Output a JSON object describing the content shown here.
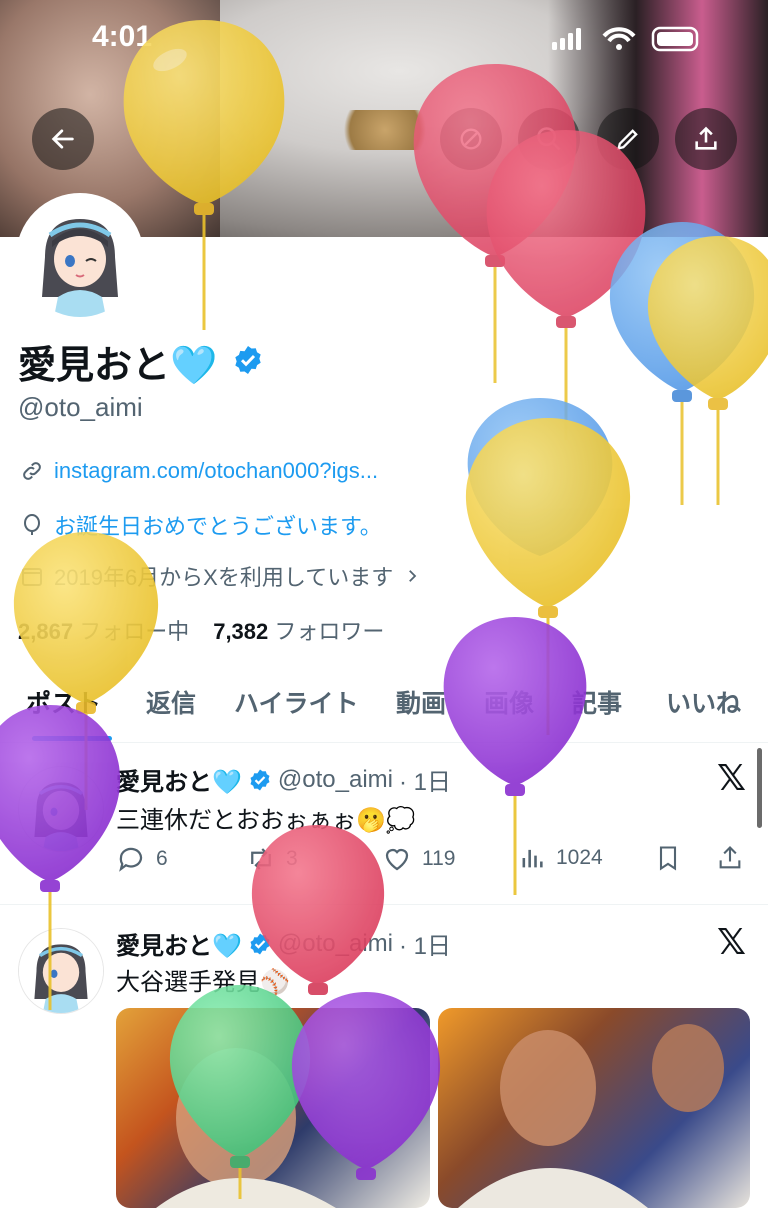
{
  "status_bar": {
    "time": "4:01"
  },
  "profile": {
    "display_name": "愛見おと🩵",
    "handle": "@oto_aimi",
    "link": "instagram.com/otochan000?igs...",
    "birthday": "お誕生日おめでとうございます。",
    "joined": "2019年6月からXを利用しています",
    "following_count": "2,867",
    "following_label": "フォロー中",
    "followers_count": "7,382",
    "followers_label": "フォロワー"
  },
  "tabs": [
    {
      "label": "ポスト"
    },
    {
      "label": "返信"
    },
    {
      "label": "ハイライト"
    },
    {
      "label": "動画"
    },
    {
      "label": "画像"
    },
    {
      "label": "記事"
    },
    {
      "label": "いいね"
    }
  ],
  "tweets": [
    {
      "name": "愛見おと🩵",
      "handle": "@oto_aimi",
      "time": "· 1日",
      "text": "三連休だとおおぉぁぉ🫢💭",
      "replies": "6",
      "retweets": "3",
      "likes": "119",
      "views": "1024"
    },
    {
      "name": "愛見おと🩵",
      "handle": "@oto_aimi",
      "time": "· 1日",
      "text": "大谷選手発見⚾️"
    }
  ],
  "icons": [
    "back-arrow-icon",
    "grok-icon",
    "search-icon",
    "edit-pencil-icon",
    "share-icon",
    "link-icon",
    "balloon-icon",
    "calendar-icon",
    "chevron-right-icon",
    "verified-badge-icon",
    "x-logo-icon",
    "reply-icon",
    "retweet-icon",
    "like-icon",
    "views-icon",
    "bookmark-icon"
  ],
  "colors": {
    "accent": "#1d9bf0",
    "text": "#0f1419",
    "secondary": "#536471"
  }
}
